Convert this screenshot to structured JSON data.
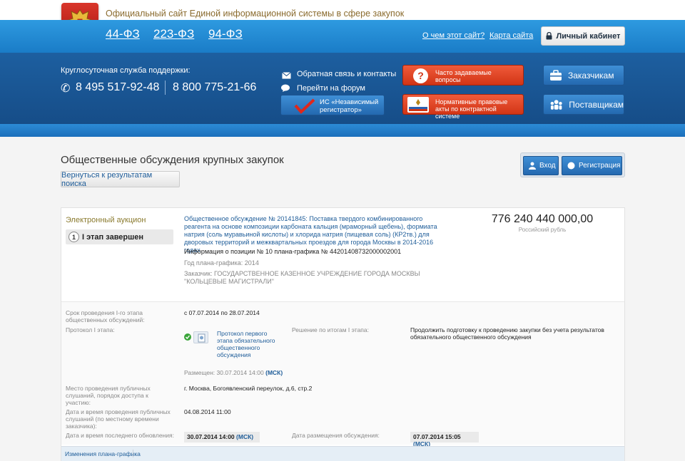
{
  "header": {
    "site_title": "Официальный сайт Единой информационной системы в сфере закупок",
    "laws": [
      "44-ФЗ",
      "223-ФЗ",
      "94-ФЗ"
    ],
    "links": {
      "about": "О чем этот сайт?",
      "sitemap": "Карта сайта"
    },
    "cabinet_label": "Личный кабинет"
  },
  "support": {
    "label": "Круглосуточная служба поддержки:",
    "phones": [
      "8 495 517-92-48",
      "8 800 775-21-66"
    ],
    "feedback": "Обратная связь и контакты",
    "forum": "Перейти на форум",
    "registrar": "ИС «Независимый регистратор»"
  },
  "quick_buttons": {
    "faq": "Часто задаваемые вопросы",
    "legal": "Нормативные правовые акты по контрактной системе",
    "customers": "Заказчикам",
    "suppliers": "Поставщикам"
  },
  "page": {
    "title": "Общественные обсуждения крупных закупок",
    "back": "Вернуться к результатам поиска",
    "login": "Вход",
    "register": "Регистрация"
  },
  "discussion": {
    "procedure_type": "Электронный аукцион",
    "stage_number": "1",
    "stage_label": "I этап завершен",
    "title": "Общественное обсуждение № 20141845: Поставка твердого комбинированного реагента на основе композиции карбоната кальция (мраморный щебень), формиата натрия (соль муравьиной кислоты) и хлорида натрия (пищевая соль) (КР2тв.) для дворовых территорий и межквартальных проездов для города Москвы в 2014-2016 годах",
    "plan_info": "Информация о позиции № 10 плана-графика № 44201408732000002001",
    "plan_year": "Год плана-графика: 2014",
    "customer_label": "Заказчик:",
    "customer": "ГОСУДАРСТВЕННОЕ КАЗЕННОЕ УЧРЕЖДЕНИЕ ГОРОДА МОСКВЫ \"КОЛЬЦЕВЫЕ МАГИСТРАЛИ\"",
    "price": "776 240 440 000,00",
    "currency": "Российский рубль"
  },
  "details": {
    "stage1_period_label": "Срок проведения I-го этапа общественных обсуждений:",
    "stage1_period": "с 07.07.2014 по 28.07.2014",
    "protocol_label": "Протокол I этапа:",
    "protocol_link": "Протокол первого этапа обязательного общественного обсуждения",
    "decision_label": "Решение по итогам I этапа:",
    "decision": "Продолжить подготовку к проведению закупки без учета результатов обязательного общественного обсуждения",
    "placed_label": "Размещен:",
    "placed_date": "30.07.2014 14:00",
    "placed_tz": "(МСК)",
    "hearing_place_label": "Место проведения публичных слушаний, порядок доступа к участию:",
    "hearing_place": "г. Москва, Богоявленский переулок, д.6, стр.2",
    "hearing_time_label": "Дата и время проведения публичных слушаний (по местному времени заказчика):",
    "hearing_time": "04.08.2014 11:00",
    "last_update_label": "Дата и время последнего обновления:",
    "last_update": "30.07.2014 14:00",
    "last_update_tz": "(МСК)",
    "posted_label": "Дата размещения обсуждения:",
    "posted": "07.07.2014 15:05",
    "posted_tz": "(МСК)"
  },
  "tabs": {
    "plan_changes": "Изменения плана-графика"
  },
  "colors": {
    "brand_blue": "#1a7cc7",
    "dark_blue": "#164d88",
    "accent_red": "#d23516",
    "link": "#1f5d99"
  }
}
